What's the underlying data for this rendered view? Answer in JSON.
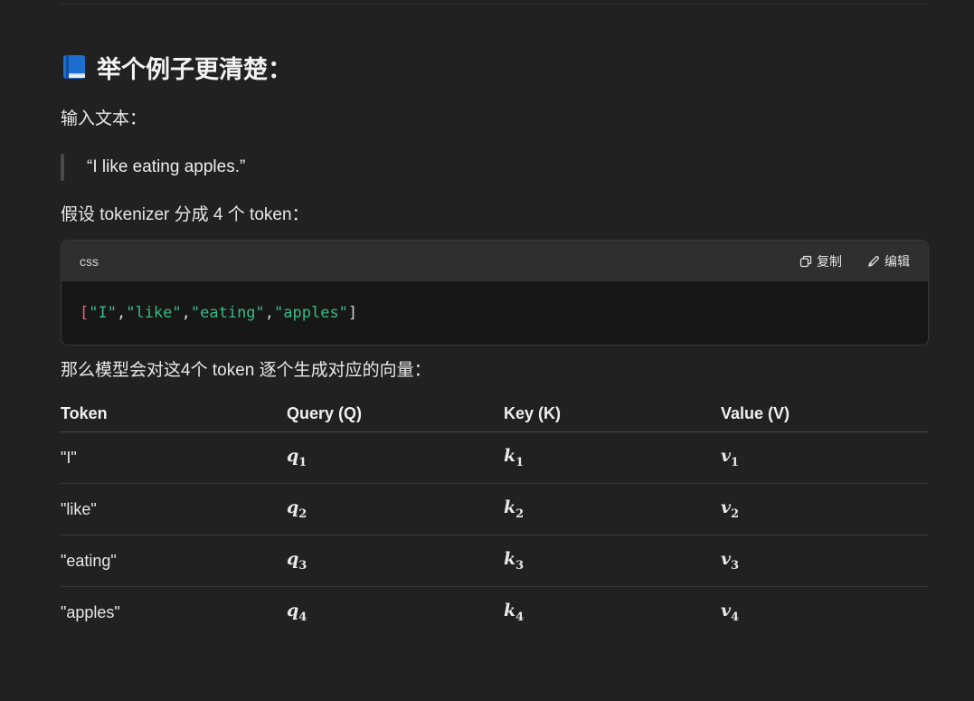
{
  "heading": {
    "text": "举个例子更清楚："
  },
  "intro_label": "输入文本：",
  "quote": "“I like eating apples.”",
  "tokenizer_line": "假设 tokenizer 分成 4 个 token：",
  "code": {
    "language": "css",
    "copy_label": "复制",
    "edit_label": "编辑",
    "open": "[",
    "tokens": [
      "\"I\"",
      "\"like\"",
      "\"eating\"",
      "\"apples\""
    ],
    "sep": ", ",
    "close": "]"
  },
  "vector_line": "那么模型会对这4个 token 逐个生成对应的向量：",
  "table": {
    "headers": [
      "Token",
      "Query (Q)",
      "Key (K)",
      "Value (V)"
    ],
    "rows": [
      {
        "token": "\"I\"",
        "q": "q",
        "q_sub": "1",
        "k": "k",
        "k_sub": "1",
        "v": "v",
        "v_sub": "1"
      },
      {
        "token": "\"like\"",
        "q": "q",
        "q_sub": "2",
        "k": "k",
        "k_sub": "2",
        "v": "v",
        "v_sub": "2"
      },
      {
        "token": "\"eating\"",
        "q": "q",
        "q_sub": "3",
        "k": "k",
        "k_sub": "3",
        "v": "v",
        "v_sub": "3"
      },
      {
        "token": "\"apples\"",
        "q": "q",
        "q_sub": "4",
        "k": "k",
        "k_sub": "4",
        "v": "v",
        "v_sub": "4"
      }
    ]
  }
}
